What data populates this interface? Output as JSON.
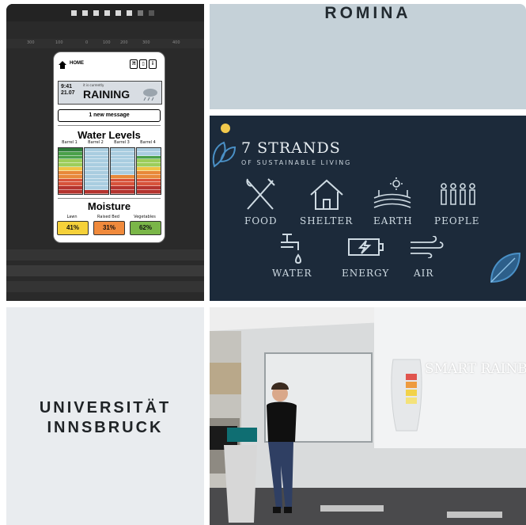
{
  "app_mockup": {
    "ruler_ticks": [
      "300",
      "100",
      "0",
      "100",
      "200",
      "300",
      "400"
    ],
    "nav": {
      "home_label": "HOME",
      "icons": [
        "wifi-icon",
        "battery-icon",
        "info-icon"
      ]
    },
    "weather": {
      "time": "9:41",
      "date": "21.07",
      "status_prefix": "it is currently",
      "condition": "RAINING"
    },
    "message_button": "1 new message",
    "water_levels": {
      "title": "Water Levels",
      "barrels": [
        {
          "label": "Barrel 1",
          "level": 1.0
        },
        {
          "label": "Barrel 2",
          "level": 0.1
        },
        {
          "label": "Barrel 3",
          "level": 0.45
        },
        {
          "label": "Barrel 4",
          "level": 0.85
        }
      ]
    },
    "moisture": {
      "title": "Moisture",
      "beds": [
        {
          "label": "Lawn",
          "value": "41%",
          "color": "#f5d13a"
        },
        {
          "label": "Raised Bed",
          "value": "31%",
          "color": "#f08a3c"
        },
        {
          "label": "Vegetables",
          "value": "62%",
          "color": "#7ab648"
        }
      ]
    }
  },
  "brand": {
    "name": "ROMINA"
  },
  "strands": {
    "title": "7 STRANDS",
    "subtitle": "OF SUSTAINABLE LIVING",
    "items": [
      {
        "label": "FOOD",
        "icon": "fork-knife-icon"
      },
      {
        "label": "SHELTER",
        "icon": "house-icon"
      },
      {
        "label": "EARTH",
        "icon": "field-sun-icon"
      },
      {
        "label": "PEOPLE",
        "icon": "people-icon"
      },
      {
        "label": "WATER",
        "icon": "faucet-icon"
      },
      {
        "label": "ENERGY",
        "icon": "battery-icon"
      },
      {
        "label": "AIR",
        "icon": "wind-icon"
      }
    ]
  },
  "university": {
    "line1": "UNIVERSITÄT",
    "line2": "INNSBRUCK"
  },
  "photo": {
    "slide_text": "SMART RAINB"
  },
  "colors": {
    "water_blue": "#a9cde0",
    "leaf": "#4a90c6",
    "dark_panel": "#1c2a3a",
    "romina_bg": "#c5d1d8"
  }
}
